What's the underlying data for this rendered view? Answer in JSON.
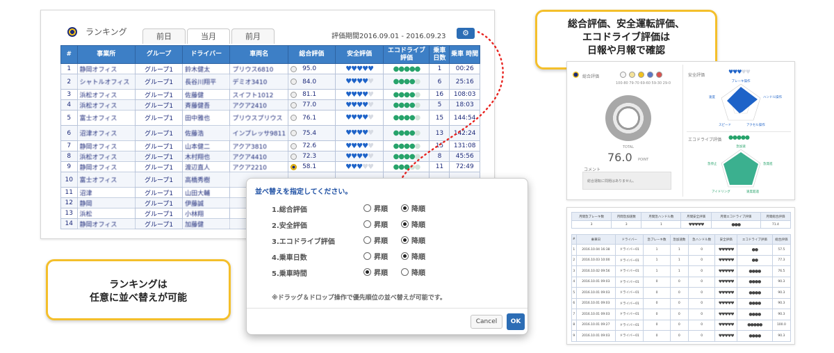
{
  "ranking": {
    "title": "ランキング",
    "tabs": [
      "前日",
      "当月",
      "前月"
    ],
    "period": "評価期間2016.09.01 - 2016.09.23",
    "gear_icon": "⚙",
    "columns": [
      "#",
      "事業所",
      "グループ",
      "ドライバー",
      "車両名",
      "総合評価",
      "安全評価",
      "エコドライブ 評価",
      "乗車 日数",
      "乗車 時間"
    ],
    "rows": [
      {
        "no": "1",
        "office": "静岡オフィス",
        "group": "グループ1",
        "driver": "鈴木健太",
        "vehicle": "プリウス6810",
        "score": "95.0",
        "hearts": 5,
        "drops": 5,
        "days": "1",
        "time": "00:26"
      },
      {
        "no": "2",
        "office": "シャトルオフィス",
        "group": "グループ1",
        "driver": "長谷川翔平",
        "vehicle": "デミオ3410",
        "score": "84.0",
        "hearts": 4,
        "drops": 4,
        "days": "6",
        "time": "25:16"
      },
      {
        "no": "3",
        "office": "浜松オフィス",
        "group": "グループ1",
        "driver": "佐藤健",
        "vehicle": "スイフト1012",
        "score": "81.1",
        "hearts": 4,
        "drops": 4,
        "days": "16",
        "time": "108:03"
      },
      {
        "no": "4",
        "office": "浜松オフィス",
        "group": "グループ1",
        "driver": "斉藤健吾",
        "vehicle": "アクア2410",
        "score": "77.0",
        "hearts": 4,
        "drops": 4,
        "days": "5",
        "time": "18:03"
      },
      {
        "no": "5",
        "office": "富士オフィス",
        "group": "グループ1",
        "driver": "田中雅也",
        "vehicle": "プリウスプリウス",
        "score": "76.1",
        "hearts": 4,
        "drops": 4,
        "days": "15",
        "time": "144:54"
      },
      {
        "no": "6",
        "office": "沼津オフィス",
        "group": "グループ1",
        "driver": "佐藤浩",
        "vehicle": "インプレッサ9811",
        "score": "75.4",
        "hearts": 4,
        "drops": 4,
        "days": "13",
        "time": "142:24"
      },
      {
        "no": "7",
        "office": "静岡オフィス",
        "group": "グループ1",
        "driver": "山本健二",
        "vehicle": "アクア3810",
        "score": "72.6",
        "hearts": 4,
        "drops": 4,
        "days": "15",
        "time": "131:08"
      },
      {
        "no": "8",
        "office": "浜松オフィス",
        "group": "グループ1",
        "driver": "木村翔也",
        "vehicle": "アクア4410",
        "score": "72.3",
        "hearts": 4,
        "drops": 4,
        "days": "8",
        "time": "45:56"
      },
      {
        "no": "9",
        "office": "静岡オフィス",
        "group": "グループ1",
        "driver": "渡辺直人",
        "vehicle": "アクア2210",
        "score": "58.1",
        "hearts": 3,
        "drops": 3,
        "days": "11",
        "time": "72:49"
      },
      {
        "no": "10",
        "office": "富士オフィス",
        "group": "グループ1",
        "driver": "高橋秀樹",
        "vehicle": "",
        "score": "",
        "hearts": 0,
        "drops": 0,
        "days": "",
        "time": ""
      },
      {
        "no": "11",
        "office": "沼津",
        "group": "グループ1",
        "driver": "山田大輔",
        "vehicle": "",
        "score": "",
        "hearts": 0,
        "drops": 0,
        "days": "",
        "time": ""
      },
      {
        "no": "12",
        "office": "静岡",
        "group": "グループ1",
        "driver": "伊藤誠",
        "vehicle": "",
        "score": "",
        "hearts": 0,
        "drops": 0,
        "days": "",
        "time": ""
      },
      {
        "no": "13",
        "office": "浜松",
        "group": "グループ1",
        "driver": "小林翔",
        "vehicle": "",
        "score": "",
        "hearts": 0,
        "drops": 0,
        "days": "",
        "time": ""
      },
      {
        "no": "14",
        "office": "静岡オフィス",
        "group": "グループ1",
        "driver": "加藤健",
        "vehicle": "",
        "score": "",
        "hearts": 0,
        "drops": 0,
        "days": "",
        "time": ""
      }
    ]
  },
  "callouts": {
    "right_line1": "総合評価、安全運転評価、",
    "right_line2": "エコドライブ評価は",
    "right_line3": "日報や月報で確認",
    "left_line1": "ランキングは",
    "left_line2": "任意に並べ替えが可能"
  },
  "sort_dialog": {
    "title": "並べ替えを指定してください。",
    "asc_label": "昇順",
    "desc_label": "降順",
    "items": [
      {
        "label": "1.総合評価",
        "selected": "desc"
      },
      {
        "label": "2.安全評価",
        "selected": "desc"
      },
      {
        "label": "3.エコドライブ評価",
        "selected": "desc"
      },
      {
        "label": "4.乗車日数",
        "selected": "desc"
      },
      {
        "label": "5.乗車時間",
        "selected": "asc"
      }
    ],
    "note": "※ドラッグ＆ドロップ操作で優先順位の並べ替えが可能です。",
    "cancel": "Cancel",
    "ok": "OK"
  },
  "daily_report": {
    "overall_label": "総合評価",
    "face_scale": "100-80 79-70 69-60 59-30 29-0",
    "total_label": "TOTAL",
    "score": "76.0",
    "unit": "POINT",
    "comment_label": "コメント",
    "comment": "総合運転に問題はありません。",
    "safety_label": "安全評価",
    "safety_hearts": 3,
    "radar_safety_labels": [
      "ブレーキ操作",
      "ハンドル操作",
      "速度",
      "スピード",
      "アクセル操作"
    ],
    "eco_label": "エコドライブ評価",
    "eco_drops": 5,
    "radar_eco_labels": [
      "急加速",
      "急発進",
      "急停止",
      "アイドリング",
      "速度超過"
    ],
    "colors": {
      "safety": "#1e63c8",
      "eco": "#27a36b"
    }
  },
  "monthly_report": {
    "summary_headers": [
      "月間急ブレーキ数",
      "月間急加速数",
      "月間急ハンドル数",
      "月間安全評価",
      "月間エコドライブ評価",
      "月間総合評価"
    ],
    "summary_values": [
      "3",
      "3",
      "1",
      "♥♥♥♥♥",
      "●●●",
      "71.4"
    ],
    "list_headers": [
      "#",
      "乗車日",
      "ドライバー",
      "急ブレーキ数",
      "急加速数",
      "急ハンドル数",
      "安全評価",
      "エコドライブ評価",
      "総合評価"
    ],
    "rows": [
      [
        "1",
        "2016.10.04 16:38",
        "ドライバー01",
        "1",
        "1",
        "0",
        "♥♥♥♥♥",
        "●●",
        "57.5"
      ],
      [
        "2",
        "2016.10.03 10:00",
        "ドライバー01",
        "1",
        "1",
        "0",
        "♥♥♥♥♥",
        "●●",
        "77.3"
      ],
      [
        "3",
        "2016.10.02 09:56",
        "ドライバー01",
        "1",
        "1",
        "0",
        "♥♥♥♥♥",
        "●●●●",
        "76.5"
      ],
      [
        "4",
        "2016.10.01 09:03",
        "ドライバー01",
        "0",
        "0",
        "0",
        "♥♥♥♥♥",
        "●●●●",
        "90.3"
      ],
      [
        "5",
        "2016.10.01 09:03",
        "ドライバー01",
        "0",
        "0",
        "0",
        "♥♥♥♥♥",
        "●●●●",
        "90.3"
      ],
      [
        "6",
        "2016.10.01 09:03",
        "ドライバー01",
        "0",
        "0",
        "0",
        "♥♥♥♥♥",
        "●●●●",
        "90.3"
      ],
      [
        "7",
        "2016.10.01 09:03",
        "ドライバー01",
        "0",
        "0",
        "0",
        "♥♥♥♥♥",
        "●●●●",
        "90.3"
      ],
      [
        "8",
        "2016.10.01 09:27",
        "ドライバー01",
        "0",
        "0",
        "0",
        "♥♥♥♥♥",
        "●●●●●",
        "100.0"
      ],
      [
        "9",
        "2016.10.01 09:03",
        "ドライバー01",
        "0",
        "0",
        "0",
        "♥♥♥♥♥",
        "●●●●",
        "90.3"
      ]
    ]
  }
}
